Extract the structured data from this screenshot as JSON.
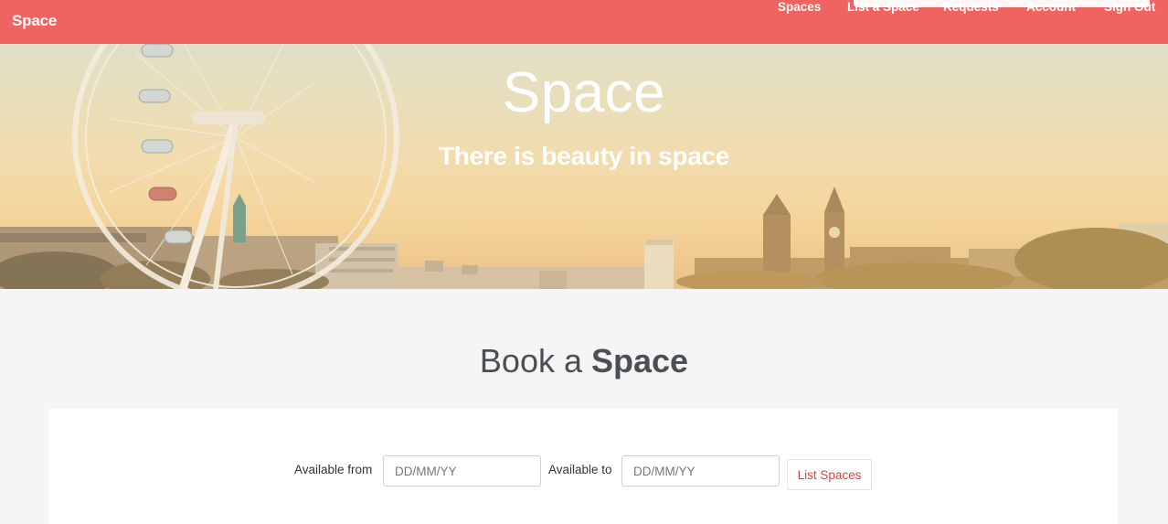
{
  "navbar": {
    "brand": "Space",
    "links": [
      "Spaces",
      "List a Space",
      "Requests",
      "Account",
      "Sign Out"
    ]
  },
  "hero": {
    "title": "Space",
    "subtitle": "There is beauty in space"
  },
  "booking": {
    "title_prefix": "Book a",
    "title_bold": "Space",
    "available_from_label": "Available from",
    "available_from_placeholder": "DD/MM/YY",
    "available_to_label": "Available to",
    "available_to_placeholder": "DD/MM/YY",
    "submit_label": "List Spaces"
  },
  "colors": {
    "brand": "#ef6460",
    "accent_text": "#e0403c"
  }
}
